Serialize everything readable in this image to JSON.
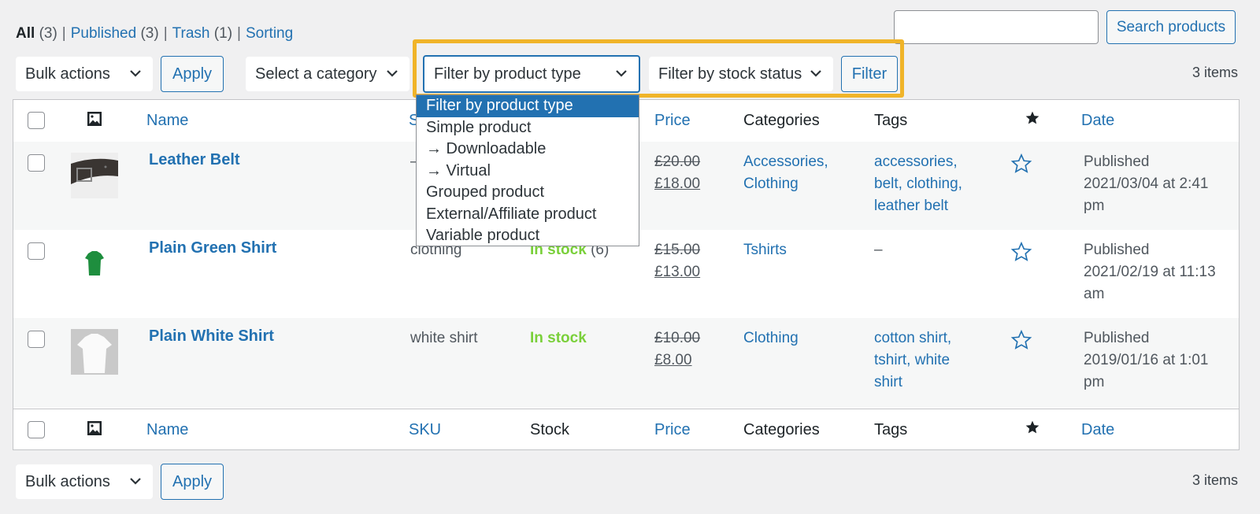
{
  "views": [
    {
      "label": "All",
      "count": "(3)",
      "current": true
    },
    {
      "label": "Published",
      "count": "(3)",
      "current": false
    },
    {
      "label": "Trash",
      "count": "(1)",
      "current": false
    },
    {
      "label": "Sorting",
      "count": "",
      "current": false
    }
  ],
  "search": {
    "placeholder": "",
    "button": "Search products"
  },
  "toolbar": {
    "bulk_actions": "Bulk actions",
    "apply": "Apply",
    "category": "Select a category",
    "product_type": "Filter by product type",
    "stock_status": "Filter by stock status",
    "filter": "Filter",
    "items": "3 items"
  },
  "dropdown": {
    "options": [
      "Filter by product type",
      "Simple product",
      "→ Downloadable",
      "→ Virtual",
      "Grouped product",
      "External/Affiliate product",
      "Variable product"
    ],
    "selected_index": 0
  },
  "columns": {
    "name": "Name",
    "sku": "SKU",
    "stock": "Stock",
    "price": "Price",
    "categories": "Categories",
    "tags": "Tags",
    "date": "Date"
  },
  "products": [
    {
      "name": "Leather Belt",
      "sku": "–",
      "stock": "",
      "stock_count": "",
      "regular_price": "£20.00",
      "sale_price": "£18.00",
      "categories": [
        "Accessories,",
        "Clothing"
      ],
      "tags": [
        "accessories,",
        "belt, clothing,",
        "leather belt"
      ],
      "date": [
        "Published",
        "2021/03/04 at 2:41",
        "pm"
      ]
    },
    {
      "name": "Plain Green Shirt",
      "sku": "clothing",
      "stock": "In stock",
      "stock_count": "(6)",
      "regular_price": "£15.00",
      "sale_price": "£13.00",
      "categories": [
        "Tshirts"
      ],
      "tags": [
        "–"
      ],
      "date": [
        "Published",
        "2021/02/19 at 11:13",
        "am"
      ]
    },
    {
      "name": "Plain White Shirt",
      "sku": "white shirt",
      "stock": "In stock",
      "stock_count": "",
      "regular_price": "£10.00",
      "sale_price": "£8.00",
      "categories": [
        "Clothing"
      ],
      "tags": [
        "cotton shirt,",
        "tshirt, white",
        "shirt"
      ],
      "date": [
        "Published",
        "2019/01/16 at 1:01",
        "pm"
      ]
    }
  ],
  "colors": {
    "accent": "#2271b1",
    "in_stock": "#7ad03a",
    "highlight": "#f0b429"
  }
}
